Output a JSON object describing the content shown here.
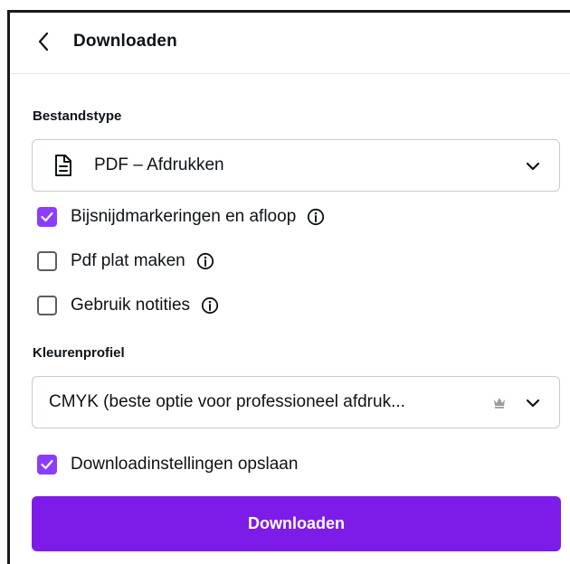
{
  "header": {
    "back_icon": "chevron-left-icon",
    "title": "Downloaden"
  },
  "file_type": {
    "label": "Bestandstype",
    "icon": "file-document-icon",
    "selected": "PDF – Afdrukken"
  },
  "pdf_options": [
    {
      "label": "Bijsnijdmarkeringen en afloop",
      "checked": true,
      "info": true
    },
    {
      "label": "Pdf plat maken",
      "checked": false,
      "info": true
    },
    {
      "label": "Gebruik notities",
      "checked": false,
      "info": true
    }
  ],
  "color_profile": {
    "label": "Kleurenprofiel",
    "selected": "CMYK (beste optie voor professioneel afdruk...",
    "premium_icon": "crown-icon"
  },
  "save_settings": {
    "label": "Downloadinstellingen opslaan",
    "checked": true
  },
  "download_button": {
    "label": "Downloaden"
  },
  "colors": {
    "accent": "#8b3dff",
    "button": "#7d1ce8",
    "text": "#0e1318",
    "border": "#c7c9cd"
  }
}
